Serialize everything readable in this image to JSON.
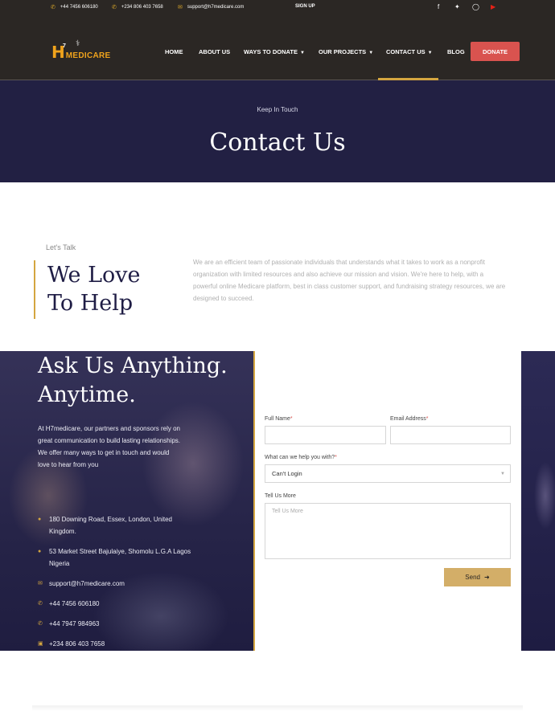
{
  "topbar": {
    "phone1": "+44 7456 606180",
    "phone2": "+234 806 403 7658",
    "email": "support@h7medicare.com",
    "signup": "SIGN UP",
    "social_icons": [
      "facebook-icon",
      "twitter-icon",
      "instagram-icon",
      "youtube-icon"
    ]
  },
  "logo": {
    "mark": "H",
    "sup": "7",
    "text": "MEDICARE"
  },
  "nav": {
    "items": [
      {
        "label": "HOME"
      },
      {
        "label": "ABOUT US"
      },
      {
        "label": "WAYS TO DONATE"
      },
      {
        "label": "OUR PROJECTS"
      },
      {
        "label": "CONTACT US"
      },
      {
        "label": "BLOG"
      }
    ],
    "donate": "DONATE"
  },
  "hero": {
    "subtitle": "Keep In Touch",
    "title": "Contact Us"
  },
  "intro": {
    "eyebrow": "Let's Talk",
    "title_line1": "We Love",
    "title_line2": "To Help",
    "text": "We are an efficient team of passionate individuals that understands what it takes to work as a nonprofit organization with limited resources and also achieve our mission and vision. We're here to help, with a powerful online Medicare platform, best in class customer support, and fundraising strategy resources, we are designed to succeed."
  },
  "contact": {
    "title_line1": "Ask Us Anything.",
    "title_line2": "Anytime.",
    "text": "At H7medicare, our partners and sponsors rely on great communication to build lasting relationships. We offer many ways to get in touch and would love to hear from you",
    "address1": "180 Downing Road, Essex, London, United Kingdom.",
    "address2": "53 Market Street Bajulaiye, Shomolu L.G.A Lagos Nigeria",
    "email": "support@h7medicare.com",
    "phone1": "+44 7456 606180",
    "phone2": "+44 7947 984963",
    "phone3": "+234 806 403 7658"
  },
  "form": {
    "full_name_label": "Full Name",
    "email_label": "Email Address",
    "required_mark": "*",
    "help_label": "What can we help you with?",
    "help_value": "Can't Login",
    "message_label": "Tell Us More",
    "message_placeholder": "Tell Us More",
    "send_label": "Send"
  },
  "colors": {
    "dark_bar": "#2b2724",
    "navy": "#222043",
    "gold": "#d4a640",
    "donate_red": "#d9534f"
  }
}
